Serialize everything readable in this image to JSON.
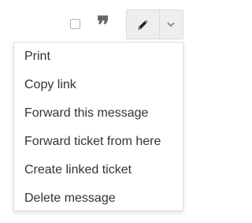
{
  "toolbar": {
    "select_icon": "checkbox-icon",
    "quote_icon": "quote-icon",
    "quote_glyph": "❞",
    "edit_icon": "pencil-icon",
    "dropdown_icon": "chevron-down-icon"
  },
  "menu": {
    "items": [
      {
        "label": "Print"
      },
      {
        "label": "Copy link"
      },
      {
        "label": "Forward this message"
      },
      {
        "label": "Forward ticket from here"
      },
      {
        "label": "Create linked ticket"
      },
      {
        "label": "Delete message"
      }
    ]
  },
  "colors": {
    "text": "#333333",
    "icon": "#666666",
    "button_bg": "#eeeeee",
    "border": "#dddddd"
  }
}
